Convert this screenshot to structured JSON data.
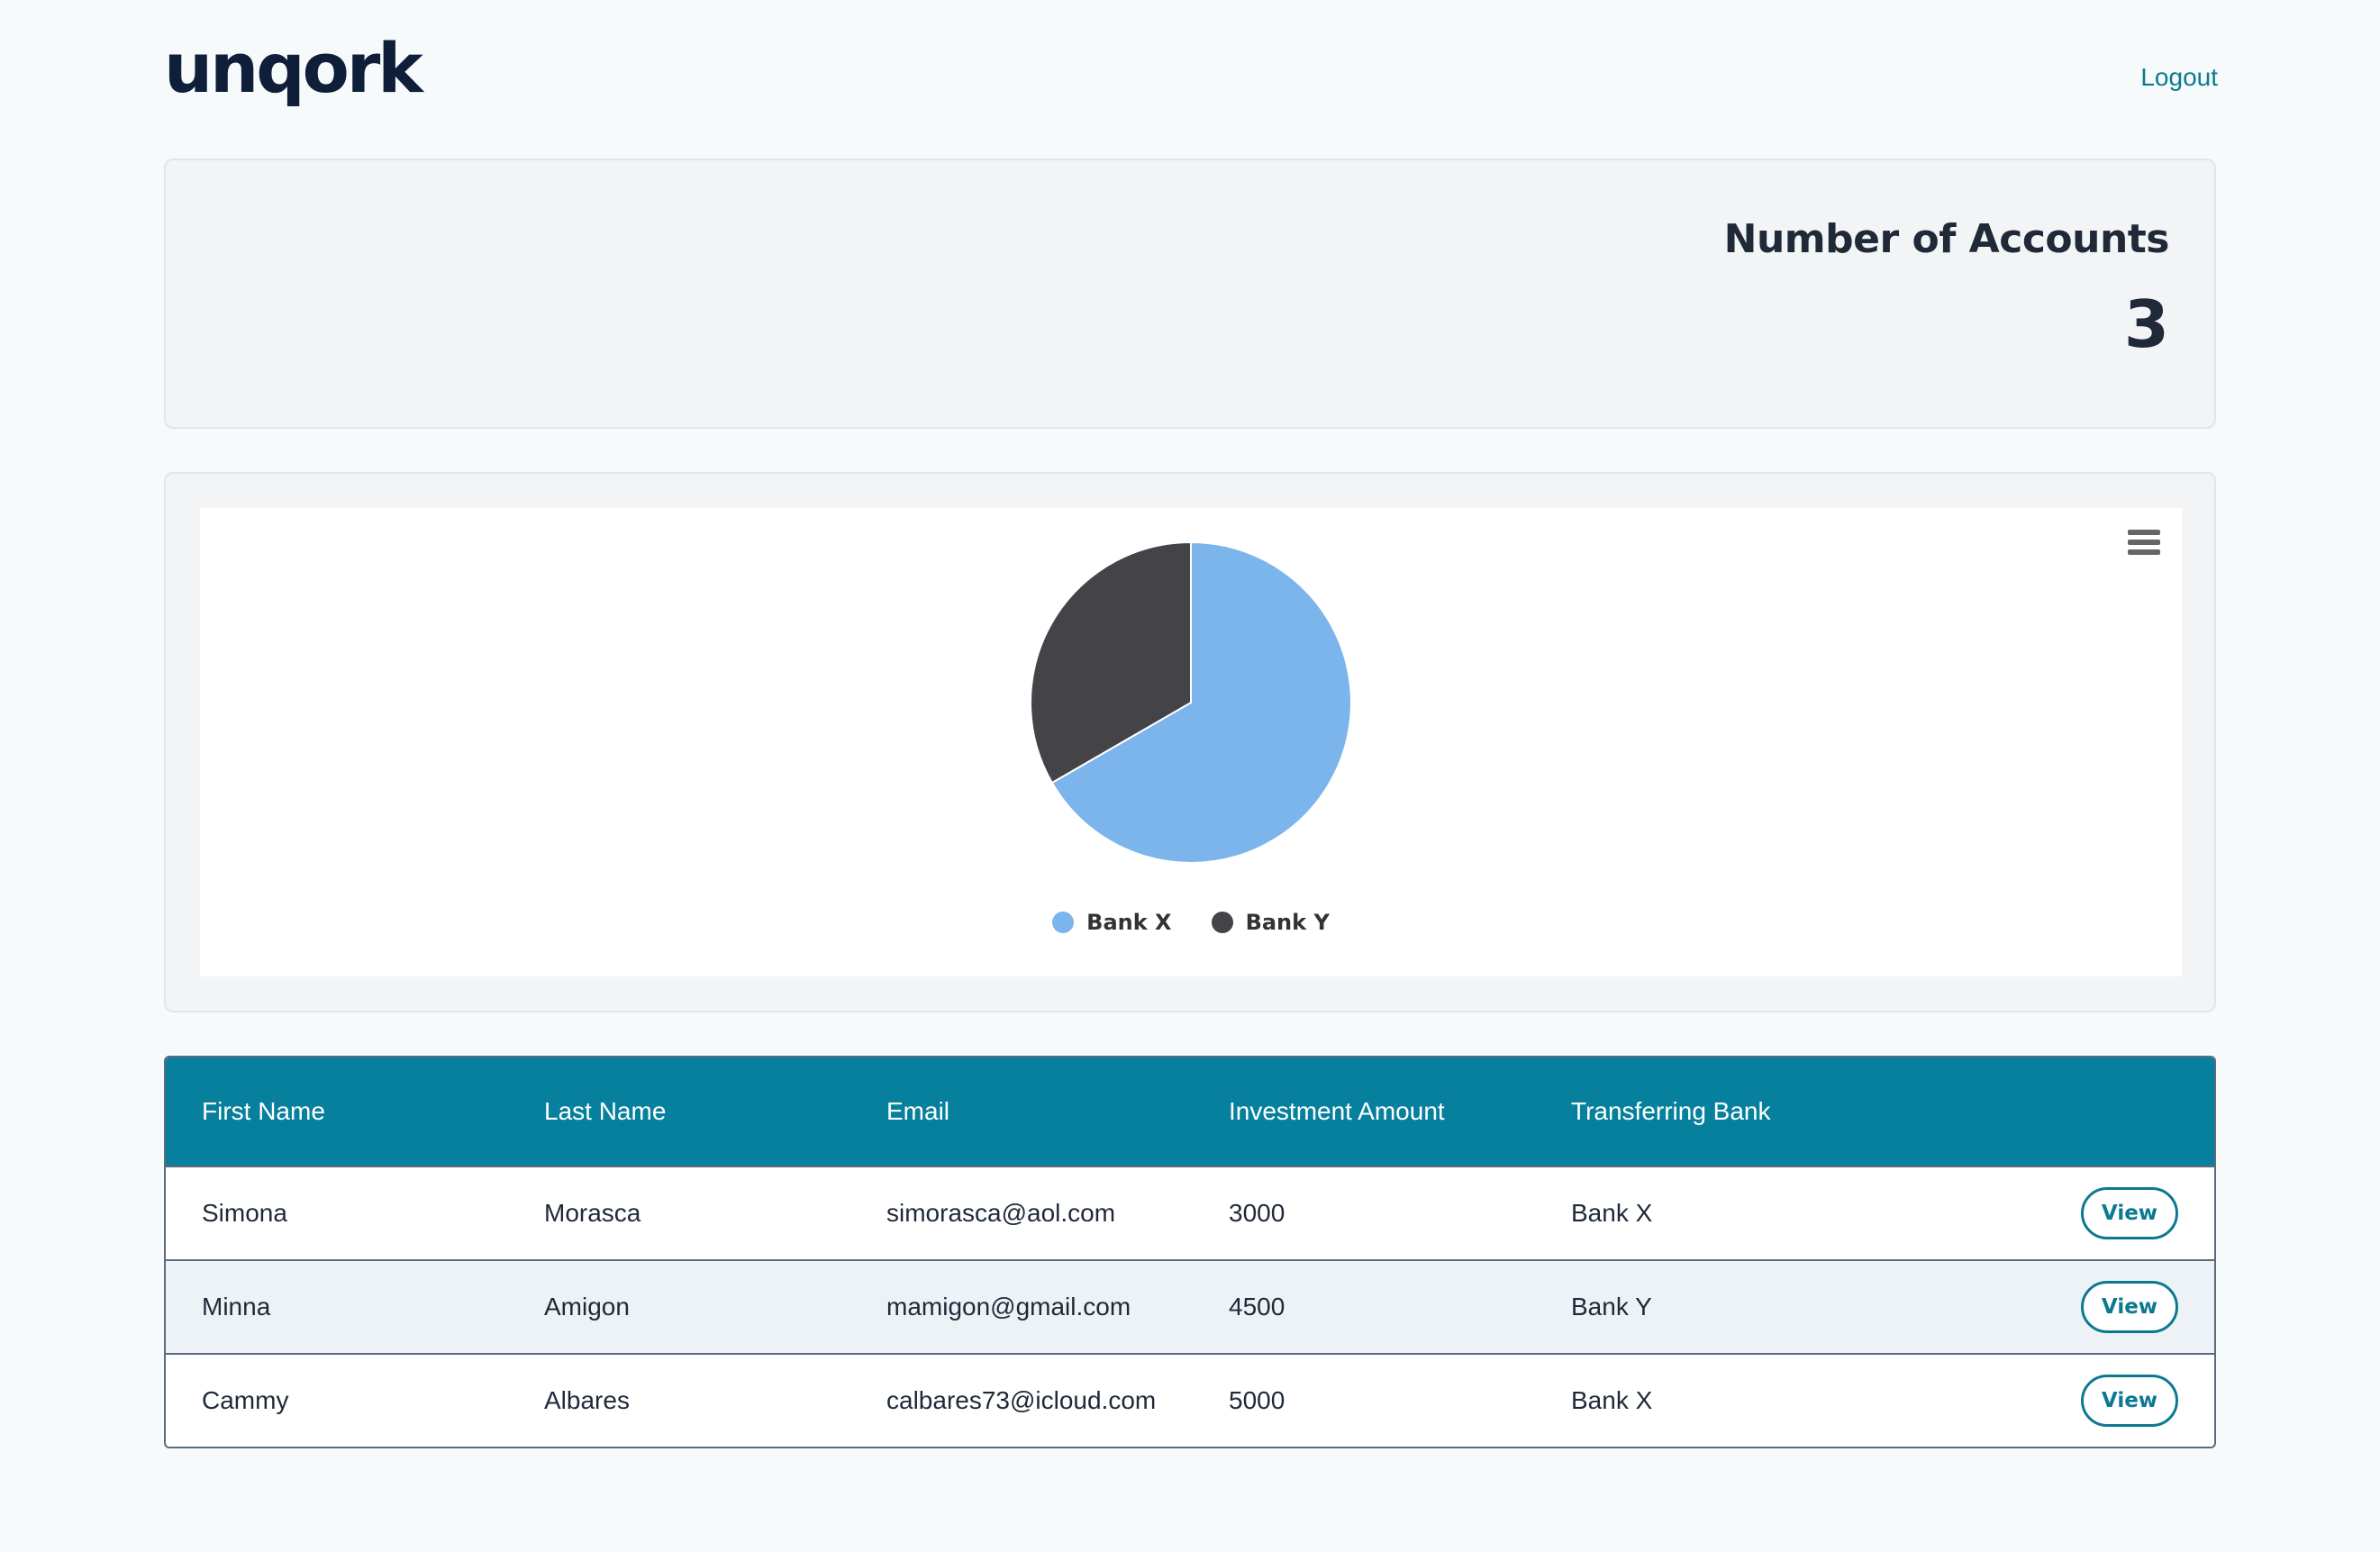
{
  "header": {
    "logo_text": "unqork",
    "logout_label": "Logout"
  },
  "accounts": {
    "title": "Number of Accounts",
    "count": "3"
  },
  "chart_data": {
    "type": "pie",
    "title": "",
    "slices": [
      {
        "name": "Bank X",
        "value": 2,
        "color": "#7cb5ec"
      },
      {
        "name": "Bank Y",
        "value": 1,
        "color": "#434348"
      }
    ],
    "legend_position": "bottom-center"
  },
  "chart_menu_icon": "hamburger-menu-icon",
  "table": {
    "headers": [
      "First Name",
      "Last Name",
      "Email",
      "Investment Amount",
      "Transferring Bank",
      ""
    ],
    "rows": [
      {
        "first": "Simona",
        "last": "Morasca",
        "email": "simorasca@aol.com",
        "amount": "3000",
        "bank": "Bank X",
        "action": "View"
      },
      {
        "first": "Minna",
        "last": "Amigon",
        "email": "mamigon@gmail.com",
        "amount": "4500",
        "bank": "Bank Y",
        "action": "View"
      },
      {
        "first": "Cammy",
        "last": "Albares",
        "email": "calbares73@icloud.com",
        "amount": "5000",
        "bank": "Bank X",
        "action": "View"
      }
    ]
  },
  "colors": {
    "accent": "#07809d",
    "brand_dark": "#0f1f3a",
    "link": "#0b7a91"
  }
}
